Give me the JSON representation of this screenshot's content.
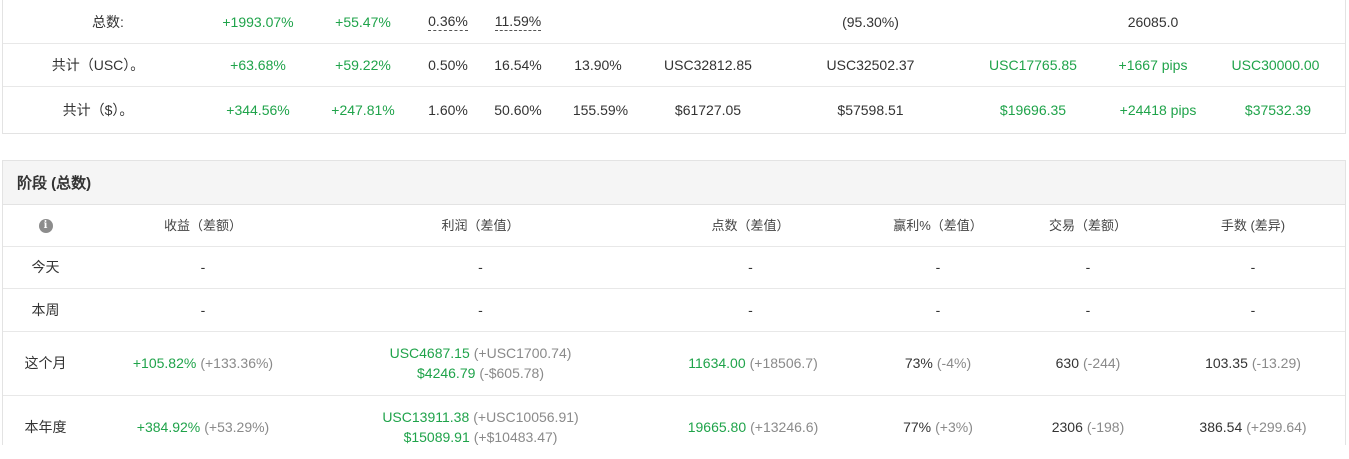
{
  "summary": {
    "rows": [
      {
        "label": "总数:",
        "gain": "+1993.07%",
        "abs": "+55.47%",
        "daily": "0.36%",
        "monthly": "11.59%",
        "drawdown": "",
        "balance": "",
        "equity": "(95.30%)",
        "highest": "",
        "profit": "26085.0",
        "interest": ""
      },
      {
        "label": "共计（USC）。",
        "gain": "+63.68%",
        "abs": "+59.22%",
        "daily": "0.50%",
        "monthly": "16.54%",
        "drawdown": "13.90%",
        "balance": "USC32812.85",
        "equity": "USC32502.37",
        "highest": "USC17765.85",
        "profit": "+1667 pips",
        "interest": "USC30000.00"
      },
      {
        "label": "共计（$）。",
        "gain": "+344.56%",
        "abs": "+247.81%",
        "daily": "1.60%",
        "monthly": "50.60%",
        "drawdown": "155.59%",
        "balance": "$61727.05",
        "equity": "$57598.51",
        "highest": "$19696.35",
        "profit": "+24418 pips",
        "interest": "$37532.39"
      }
    ]
  },
  "period": {
    "title": "阶段 (总数)",
    "headers": {
      "info": "i",
      "gain": "收益（差额）",
      "profit": "利润（差值）",
      "pips": "点数（差值）",
      "win": "赢利%（差值）",
      "trades": "交易（差额）",
      "lots": "手数 (差异)"
    },
    "rows": [
      {
        "label": "今天",
        "gain": "-",
        "gain_diff": "",
        "profit1": "-",
        "profit1_diff": "",
        "profit2": "",
        "profit2_diff": "",
        "pips": "-",
        "pips_diff": "",
        "win": "-",
        "win_diff": "",
        "trades": "-",
        "trades_diff": "",
        "lots": "-",
        "lots_diff": ""
      },
      {
        "label": "本周",
        "gain": "-",
        "gain_diff": "",
        "profit1": "-",
        "profit1_diff": "",
        "profit2": "",
        "profit2_diff": "",
        "pips": "-",
        "pips_diff": "",
        "win": "-",
        "win_diff": "",
        "trades": "-",
        "trades_diff": "",
        "lots": "-",
        "lots_diff": ""
      },
      {
        "label": "这个月",
        "gain": "+105.82%",
        "gain_diff": "(+133.36%)",
        "profit1": "USC4687.15",
        "profit1_diff": "(+USC1700.74)",
        "profit2": "$4246.79",
        "profit2_diff": "(-$605.78)",
        "pips": "11634.00",
        "pips_diff": "(+18506.7)",
        "win": "73%",
        "win_diff": "(-4%)",
        "trades": "630",
        "trades_diff": "(-244)",
        "lots": "103.35",
        "lots_diff": "(-13.29)"
      },
      {
        "label": "本年度",
        "gain": "+384.92%",
        "gain_diff": "(+53.29%)",
        "profit1": "USC13911.38",
        "profit1_diff": "(+USC10056.91)",
        "profit2": "$15089.91",
        "profit2_diff": "(+$10483.47)",
        "pips": "19665.80",
        "pips_diff": "(+13246.6)",
        "win": "77%",
        "win_diff": "(+3%)",
        "trades": "2306",
        "trades_diff": "(-198)",
        "lots": "386.54",
        "lots_diff": "(+299.64)"
      }
    ]
  },
  "colors": {
    "positive": "#1fa34a",
    "muted": "#8a8a8a",
    "header_bg": "#f5f5f5",
    "border": "#e3e3e3"
  }
}
